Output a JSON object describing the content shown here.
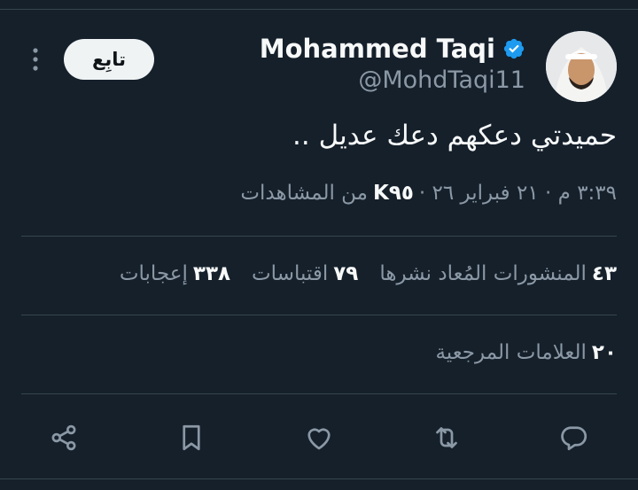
{
  "author": {
    "name": "Mohammed Taqi",
    "handle": "@MohdTaqi11",
    "verified": true,
    "verified_color": "#1d9bf0"
  },
  "follow_button": {
    "label": "تابِع"
  },
  "more_menu": {
    "icon": "more-vertical-icon"
  },
  "tweet": {
    "text": "حميدتي دعكهم دعك عديل .."
  },
  "meta": {
    "time_date": "٣:٣٩ م · ٢١ فبراير ٢٦ ·",
    "views_count": "K٩٥",
    "views_label": "من المشاهدات"
  },
  "stats": {
    "retweets": {
      "count": "٤٣",
      "label": "المنشورات المُعاد نشرها"
    },
    "quotes": {
      "count": "٧٩",
      "label": "اقتباسات"
    },
    "likes": {
      "count": "٣٣٨",
      "label": "إعجابات"
    }
  },
  "bookmarks": {
    "count": "٢٠",
    "label": "العلامات المرجعية"
  },
  "actions": [
    {
      "name": "reply-icon"
    },
    {
      "name": "retweet-icon"
    },
    {
      "name": "like-icon"
    },
    {
      "name": "bookmark-icon"
    },
    {
      "name": "share-icon"
    }
  ],
  "colors": {
    "background": "#15202b",
    "text_primary": "#f7f9f9",
    "text_secondary": "#8b98a5",
    "divider": "#38444d"
  }
}
